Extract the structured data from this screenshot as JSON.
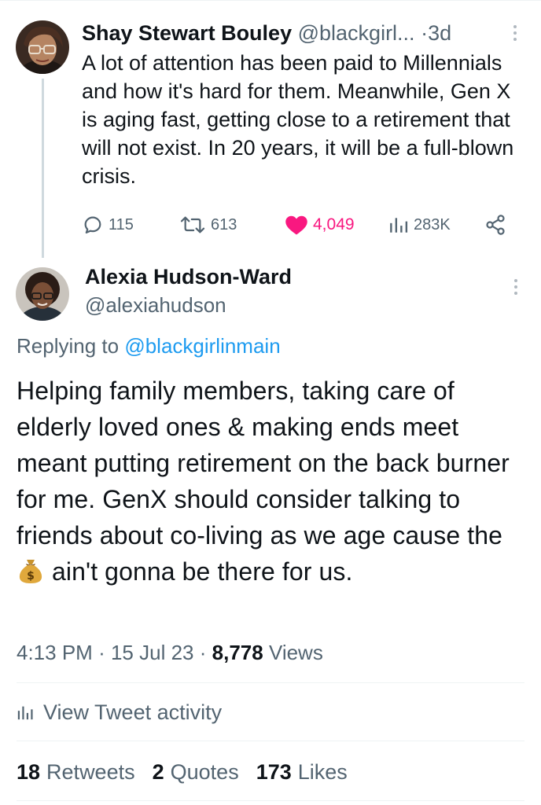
{
  "parent_tweet": {
    "author_name": "Shay Stewart Bouley",
    "author_handle": "@blackgirl...",
    "separator": "·",
    "time_ago": "3d",
    "text": "A lot of attention has been paid to Millennials and how it's hard for them. Meanwhile, Gen X is aging fast, getting close to a retirement that will not exist. In 20 years, it will be a full-blown crisis.",
    "replies": "115",
    "retweets": "613",
    "likes": "4,049",
    "views": "283K",
    "liked": true
  },
  "focused_tweet": {
    "author_name": "Alexia Hudson-Ward",
    "author_handle": "@alexiahudson",
    "replying_prefix": "Replying to",
    "replying_to": "@blackgirlinmain",
    "text_before_emoji": "Helping family members, taking care of elderly loved ones & making ends meet meant putting retirement on the back burner for me. GenX should consider talking to friends about co-living as we age cause the ",
    "emoji": "money-bag",
    "text_after_emoji": " ain't gonna be there for us.",
    "time": "4:13 PM",
    "separator": "·",
    "date": "15 Jul 23",
    "views_count": "8,778",
    "views_label": "Views",
    "activity_label": "View Tweet activity",
    "retweets_count": "18",
    "retweets_label": "Retweets",
    "quotes_count": "2",
    "quotes_label": "Quotes",
    "likes_count": "173",
    "likes_label": "Likes"
  },
  "colors": {
    "text": "#0f1419",
    "secondary": "#536471",
    "link": "#1d9bf0",
    "like": "#f91880",
    "divider": "#eff3f4",
    "thread_line": "#cfd9de"
  }
}
